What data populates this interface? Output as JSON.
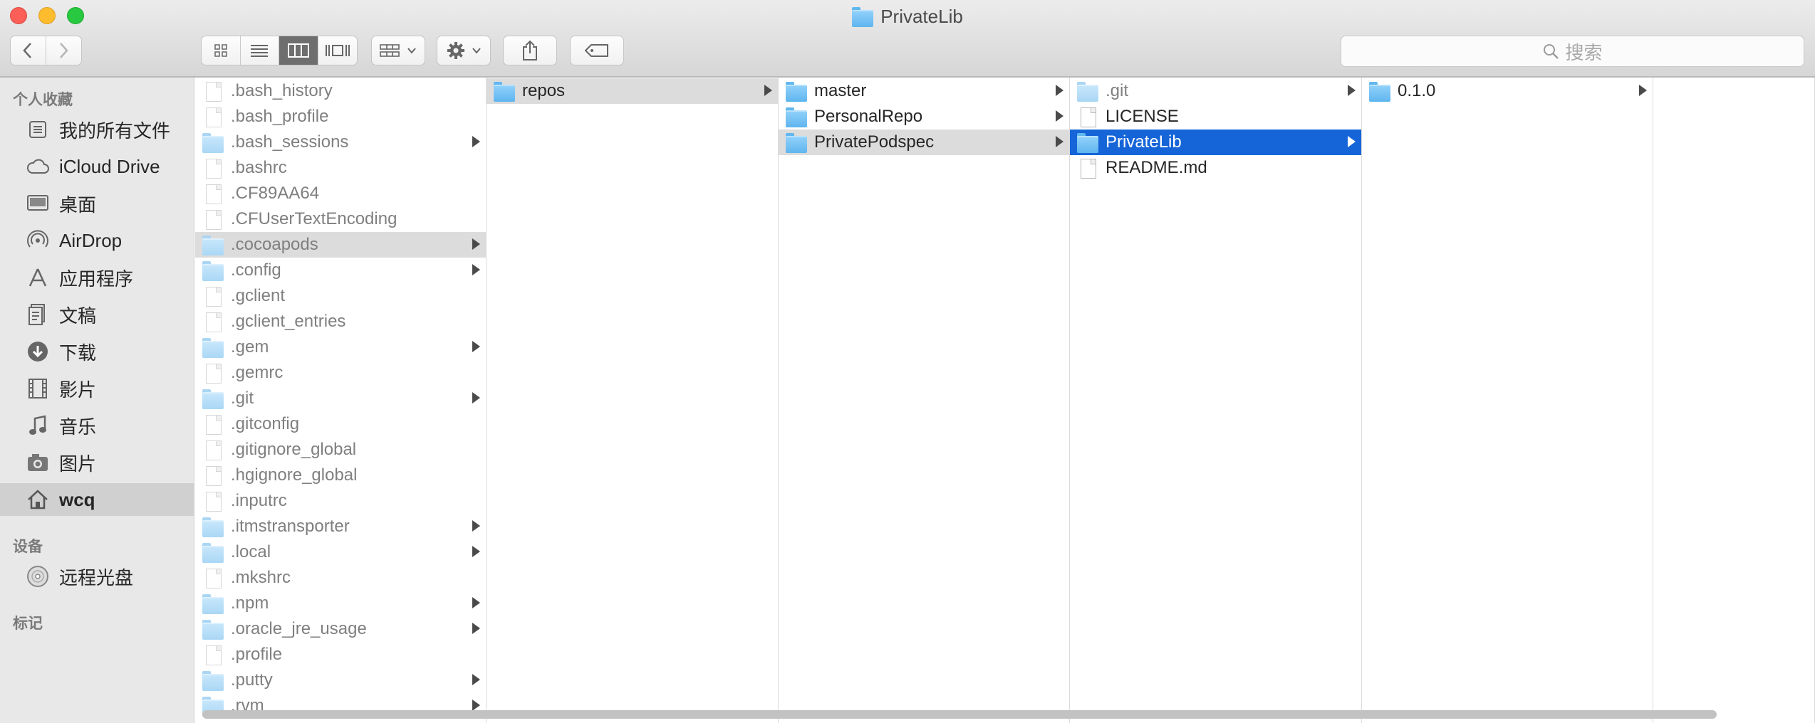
{
  "window": {
    "title": "PrivateLib"
  },
  "toolbar": {
    "back": "back",
    "forward": "forward",
    "view_modes": [
      "icon-view",
      "list-view",
      "column-view",
      "cover-flow-view"
    ],
    "active_view": "column-view",
    "search_placeholder": "搜索"
  },
  "sidebar": {
    "favorites_header": "个人收藏",
    "favorites": [
      {
        "label": "我的所有文件",
        "icon": "all-files-icon"
      },
      {
        "label": "iCloud Drive",
        "icon": "cloud-icon"
      },
      {
        "label": "桌面",
        "icon": "desktop-icon"
      },
      {
        "label": "AirDrop",
        "icon": "airdrop-icon"
      },
      {
        "label": "应用程序",
        "icon": "applications-icon"
      },
      {
        "label": "文稿",
        "icon": "documents-icon"
      },
      {
        "label": "下载",
        "icon": "downloads-icon"
      },
      {
        "label": "影片",
        "icon": "movies-icon"
      },
      {
        "label": "音乐",
        "icon": "music-icon"
      },
      {
        "label": "图片",
        "icon": "pictures-icon"
      },
      {
        "label": "wcq",
        "icon": "home-icon",
        "selected": true
      }
    ],
    "devices_header": "设备",
    "devices": [
      {
        "label": "远程光盘",
        "icon": "disc-icon"
      }
    ],
    "tags_header": "标记"
  },
  "columns": [
    {
      "items": [
        {
          "name": ".bash_history",
          "kind": "file",
          "hidden": true
        },
        {
          "name": ".bash_profile",
          "kind": "file",
          "hidden": true
        },
        {
          "name": ".bash_sessions",
          "kind": "folder",
          "hidden": true,
          "has_children": true
        },
        {
          "name": ".bashrc",
          "kind": "file",
          "hidden": true
        },
        {
          "name": ".CF89AA64",
          "kind": "file",
          "hidden": true
        },
        {
          "name": ".CFUserTextEncoding",
          "kind": "file",
          "hidden": true
        },
        {
          "name": ".cocoapods",
          "kind": "folder",
          "hidden": true,
          "has_children": true,
          "selected": "gray"
        },
        {
          "name": ".config",
          "kind": "folder",
          "hidden": true,
          "has_children": true
        },
        {
          "name": ".gclient",
          "kind": "file",
          "hidden": true
        },
        {
          "name": ".gclient_entries",
          "kind": "file",
          "hidden": true
        },
        {
          "name": ".gem",
          "kind": "folder",
          "hidden": true,
          "has_children": true
        },
        {
          "name": ".gemrc",
          "kind": "file",
          "hidden": true
        },
        {
          "name": ".git",
          "kind": "folder",
          "hidden": true,
          "has_children": true
        },
        {
          "name": ".gitconfig",
          "kind": "file",
          "hidden": true
        },
        {
          "name": ".gitignore_global",
          "kind": "file",
          "hidden": true
        },
        {
          "name": ".hgignore_global",
          "kind": "file",
          "hidden": true
        },
        {
          "name": ".inputrc",
          "kind": "file",
          "hidden": true
        },
        {
          "name": ".itmstransporter",
          "kind": "folder",
          "hidden": true,
          "has_children": true
        },
        {
          "name": ".local",
          "kind": "folder",
          "hidden": true,
          "has_children": true
        },
        {
          "name": ".mkshrc",
          "kind": "file",
          "hidden": true
        },
        {
          "name": ".npm",
          "kind": "folder",
          "hidden": true,
          "has_children": true
        },
        {
          "name": ".oracle_jre_usage",
          "kind": "folder",
          "hidden": true,
          "has_children": true
        },
        {
          "name": ".profile",
          "kind": "file",
          "hidden": true
        },
        {
          "name": ".putty",
          "kind": "folder",
          "hidden": true,
          "has_children": true
        },
        {
          "name": ".rvm",
          "kind": "folder",
          "hidden": true,
          "has_children": true
        }
      ]
    },
    {
      "items": [
        {
          "name": "repos",
          "kind": "folder",
          "has_children": true,
          "selected": "gray"
        }
      ]
    },
    {
      "items": [
        {
          "name": "master",
          "kind": "folder",
          "has_children": true
        },
        {
          "name": "PersonalRepo",
          "kind": "folder",
          "has_children": true
        },
        {
          "name": "PrivatePodspec",
          "kind": "folder",
          "has_children": true,
          "selected": "gray"
        }
      ]
    },
    {
      "items": [
        {
          "name": ".git",
          "kind": "folder",
          "hidden": true,
          "has_children": true
        },
        {
          "name": "LICENSE",
          "kind": "file"
        },
        {
          "name": "PrivateLib",
          "kind": "folder",
          "has_children": true,
          "selected": "blue"
        },
        {
          "name": "README.md",
          "kind": "file"
        }
      ]
    },
    {
      "items": [
        {
          "name": "0.1.0",
          "kind": "folder",
          "has_children": true
        }
      ]
    },
    {
      "items": []
    }
  ]
}
